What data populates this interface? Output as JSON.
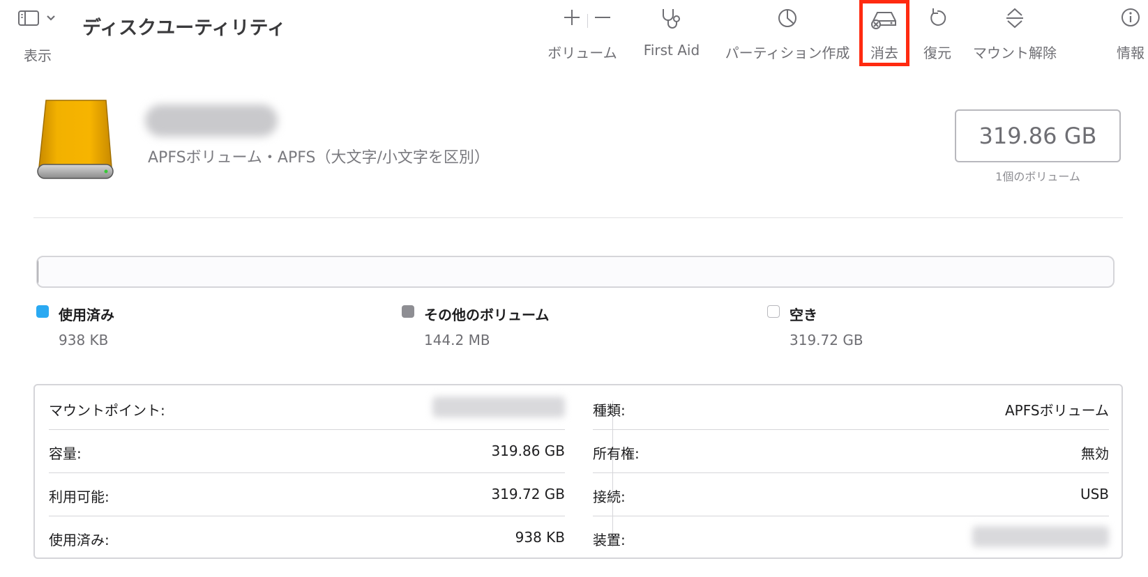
{
  "app": {
    "title": "ディスクユーティリティ",
    "view_label": "表示"
  },
  "toolbar": {
    "volume_label": "ボリューム",
    "first_aid_label": "First Aid",
    "partition_label": "パーティション作成",
    "erase_label": "消去",
    "restore_label": "復元",
    "unmount_label": "マウント解除",
    "info_label": "情報",
    "highlight_color": "#ff2a10"
  },
  "volume": {
    "description": "APFSボリューム・APFS（大文字/小文字を区別）",
    "capacity": "319.86 GB",
    "volume_count": "1個のボリューム",
    "icon": "external-drive-icon"
  },
  "usage": {
    "used": {
      "label": "使用済み",
      "value": "938 KB",
      "color": "#2aa9f2",
      "fraction": 0.0
    },
    "other": {
      "label": "その他のボリューム",
      "value": "144.2 MB",
      "color": "#8e8e93",
      "fraction": 0.0005
    },
    "free": {
      "label": "空き",
      "value": "319.72 GB",
      "color": "#ffffff"
    }
  },
  "info": {
    "left": [
      {
        "key": "マウントポイント:",
        "value": ""
      },
      {
        "key": "容量:",
        "value": "319.86 GB"
      },
      {
        "key": "利用可能:",
        "value": "319.72 GB"
      },
      {
        "key": "使用済み:",
        "value": "938 KB"
      }
    ],
    "right": [
      {
        "key": "種類:",
        "value": "APFSボリューム"
      },
      {
        "key": "所有権:",
        "value": "無効"
      },
      {
        "key": "接続:",
        "value": "USB"
      },
      {
        "key": "装置:",
        "value": ""
      }
    ]
  }
}
